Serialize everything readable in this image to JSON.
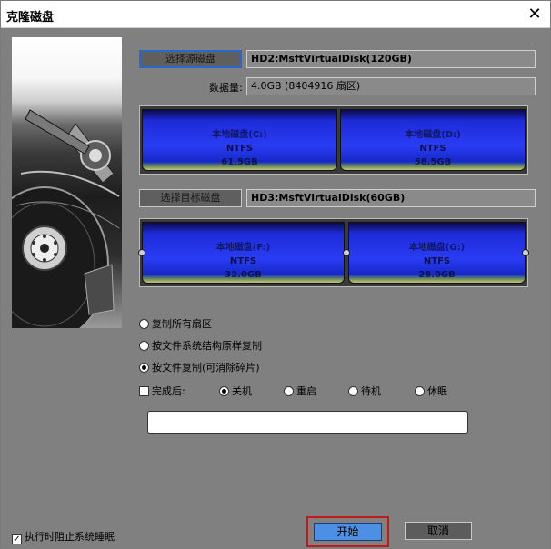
{
  "window": {
    "title": "克隆磁盘",
    "close_glyph": "✕"
  },
  "source": {
    "button_label": "选择源磁盘",
    "disk_name": "HD2:MsftVirtualDisk(120GB)",
    "data_amount_label": "数据量:",
    "data_amount_value": "4.0GB (8404916 扇区)",
    "partitions": [
      {
        "name": "本地磁盘(C:)",
        "fs": "NTFS",
        "size": "61.5GB"
      },
      {
        "name": "本地磁盘(D:)",
        "fs": "NTFS",
        "size": "58.5GB"
      }
    ]
  },
  "target": {
    "button_label": "选择目标磁盘",
    "disk_name": "HD3:MsftVirtualDisk(60GB)",
    "partitions": [
      {
        "name": "本地磁盘(F:)",
        "fs": "NTFS",
        "size": "32.0GB"
      },
      {
        "name": "本地磁盘(G:)",
        "fs": "NTFS",
        "size": "28.0GB"
      }
    ]
  },
  "options": {
    "copy_all_sectors": "复制所有扇区",
    "copy_by_structure": "按文件系统结构原样复制",
    "copy_by_file": "按文件复制(可消除碎片)",
    "selected": "copy_by_file"
  },
  "after_complete": {
    "label": "完成后:",
    "checked": false,
    "choices": [
      "关机",
      "重启",
      "待机",
      "休眠"
    ],
    "selected": "关机"
  },
  "footer": {
    "prevent_sleep_label": "执行时阻止系统睡眠",
    "prevent_sleep_checked": true,
    "checkbox_glyph": "✓",
    "start_label": "开始",
    "cancel_label": "取消"
  }
}
